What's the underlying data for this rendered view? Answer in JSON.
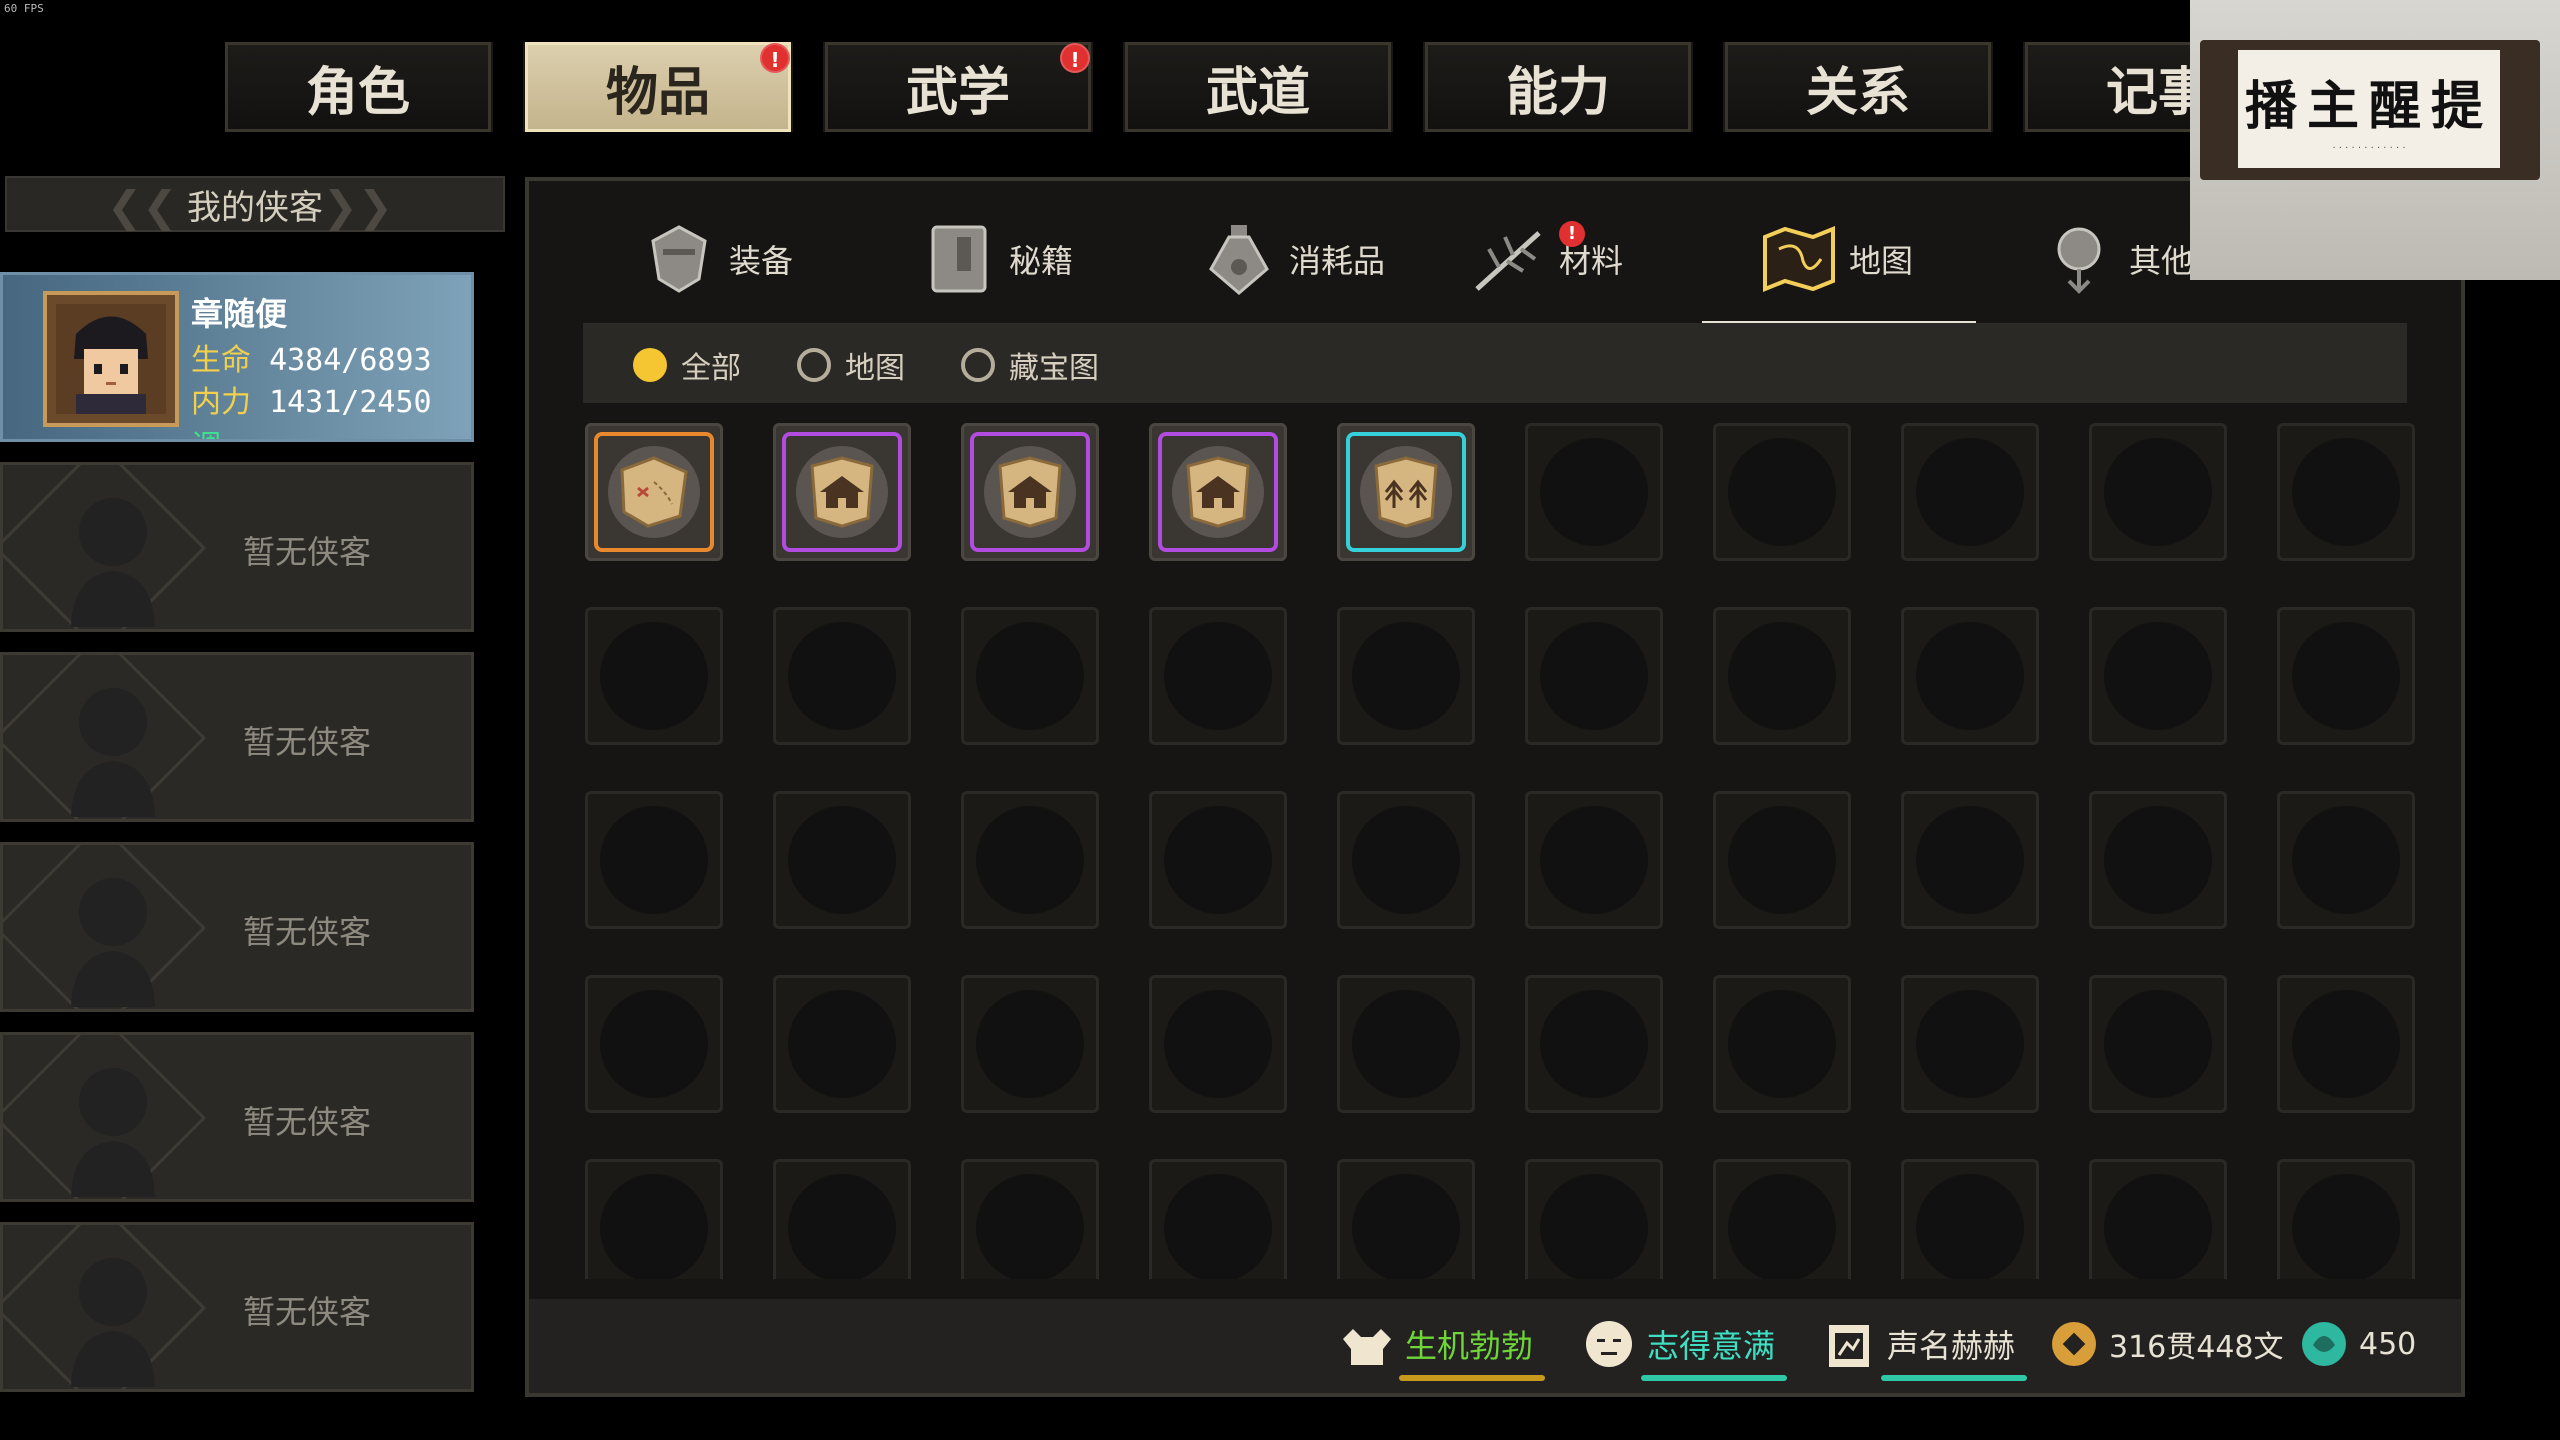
{
  "fps": "60 FPS",
  "top_tabs": [
    {
      "label": "角色",
      "badge": ""
    },
    {
      "label": "物品",
      "badge": "!"
    },
    {
      "label": "武学",
      "badge": "!"
    },
    {
      "label": "武道",
      "badge": ""
    },
    {
      "label": "能力",
      "badge": ""
    },
    {
      "label": "关系",
      "badge": ""
    },
    {
      "label": "记事",
      "badge": ""
    }
  ],
  "active_top_tab": "物品",
  "left_panel": {
    "header": "我的侠客",
    "active_character": {
      "name": "章随便",
      "hp_label": "生命",
      "hp": "4384/6893",
      "mp_label": "内力",
      "mp": "1431/2450",
      "mp_tag": "调"
    },
    "empty_label": "暂无侠客"
  },
  "category_tabs": [
    {
      "label": "装备",
      "icon": "armor-icon",
      "badge": ""
    },
    {
      "label": "秘籍",
      "icon": "book-icon",
      "badge": ""
    },
    {
      "label": "消耗品",
      "icon": "potion-icon",
      "badge": ""
    },
    {
      "label": "材料",
      "icon": "herb-icon",
      "badge": "!"
    },
    {
      "label": "地图",
      "icon": "map-icon",
      "badge": ""
    },
    {
      "label": "其他",
      "icon": "misc-icon",
      "badge": "!"
    }
  ],
  "active_category": "地图",
  "filters": [
    {
      "label": "全部",
      "checked": true
    },
    {
      "label": "地图",
      "checked": false
    },
    {
      "label": "藏宝图",
      "checked": false
    }
  ],
  "items": [
    {
      "frame_color": "#e8892e",
      "icon": "treasure-map-icon"
    },
    {
      "frame_color": "#b24ce0",
      "icon": "building-map-icon"
    },
    {
      "frame_color": "#b24ce0",
      "icon": "building-map-icon"
    },
    {
      "frame_color": "#b24ce0",
      "icon": "building-map-icon"
    },
    {
      "frame_color": "#35d0d8",
      "icon": "forest-map-icon"
    }
  ],
  "status_bar": {
    "health_status": "生机勃勃",
    "mood_status": "志得意满",
    "fame_status": "声名赫赫",
    "money": "316贯448文",
    "jade": "450"
  },
  "colors": {
    "health": "#6fd63a",
    "mood": "#3ee0c4",
    "fame": "#e8e2d4",
    "accent_gold": "#f5c631",
    "badge_red": "#e03030"
  },
  "webcam_overlay": {
    "calligraphy": "播主醒提"
  }
}
